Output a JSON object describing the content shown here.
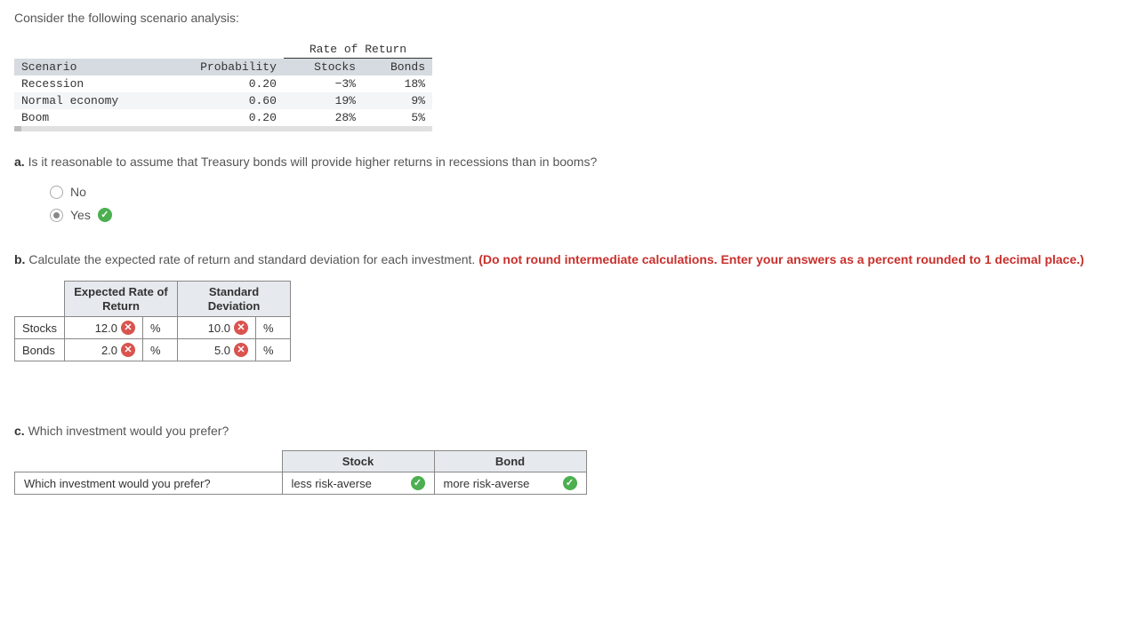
{
  "intro": "Consider the following scenario analysis:",
  "scenario_table": {
    "ror_header": "Rate of Return",
    "headers": {
      "scenario": "Scenario",
      "probability": "Probability",
      "stocks": "Stocks",
      "bonds": "Bonds"
    },
    "rows": [
      {
        "scenario": "Recession",
        "probability": "0.20",
        "stocks": "−3%",
        "bonds": "18%"
      },
      {
        "scenario": "Normal economy",
        "probability": "0.60",
        "stocks": "19%",
        "bonds": "9%"
      },
      {
        "scenario": "Boom",
        "probability": "0.20",
        "stocks": "28%",
        "bonds": "5%"
      }
    ]
  },
  "qa": {
    "label": "a.",
    "text": "Is it reasonable to assume that Treasury bonds will provide higher returns in recessions than in booms?",
    "options": {
      "no": "No",
      "yes": "Yes"
    }
  },
  "qb": {
    "label": "b.",
    "text": "Calculate the expected rate of return and standard deviation for each investment. ",
    "note": "(Do not round intermediate calculations. Enter your answers as a percent rounded to 1 decimal place.)",
    "headers": {
      "expected": "Expected Rate of Return",
      "stdev": "Standard Deviation"
    },
    "rows": {
      "stocks": {
        "label": "Stocks",
        "expected": "12.0",
        "stdev": "10.0"
      },
      "bonds": {
        "label": "Bonds",
        "expected": "2.0",
        "stdev": "5.0"
      }
    },
    "unit": "%"
  },
  "qc": {
    "label": "c.",
    "text": "Which investment would you prefer?",
    "headers": {
      "stock": "Stock",
      "bond": "Bond"
    },
    "row_label": "Which investment would you prefer?",
    "stock_answer": "less risk-averse",
    "bond_answer": "more risk-averse"
  }
}
